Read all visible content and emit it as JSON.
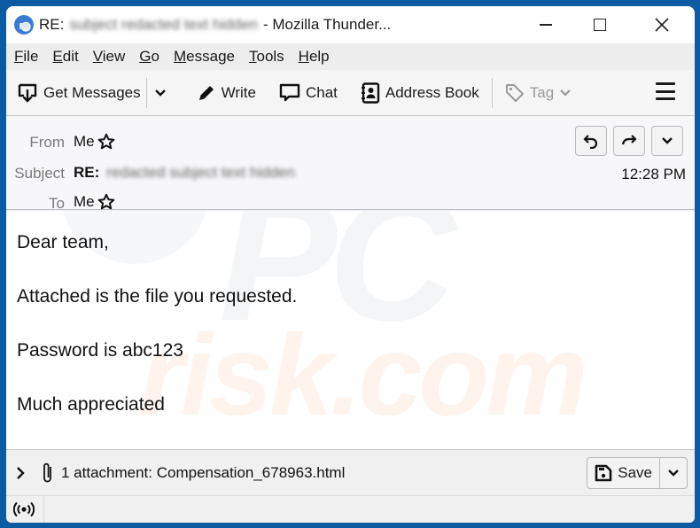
{
  "window": {
    "title_prefix": "RE:",
    "title_redacted": "subject redacted text hidden",
    "title_suffix": "- Mozilla Thunder..."
  },
  "menubar": {
    "items": [
      {
        "key": "F",
        "rest": "ile"
      },
      {
        "key": "E",
        "rest": "dit"
      },
      {
        "key": "V",
        "rest": "iew"
      },
      {
        "key": "G",
        "rest": "o"
      },
      {
        "key": "M",
        "rest": "essage"
      },
      {
        "key": "T",
        "rest": "ools"
      },
      {
        "key": "H",
        "rest": "elp"
      }
    ]
  },
  "toolbar": {
    "get_messages": "Get Messages",
    "write": "Write",
    "chat": "Chat",
    "address_book": "Address Book",
    "tag": "Tag"
  },
  "header": {
    "from_label": "From",
    "from_value": "Me",
    "subject_label": "Subject",
    "subject_prefix": "RE:",
    "subject_redacted": "redacted subject text hidden",
    "to_label": "To",
    "to_value": "Me",
    "time": "12:28 PM"
  },
  "body": {
    "paragraphs": [
      "Dear team,",
      "Attached is the file you requested.",
      "Password is abc123",
      "Much appreciated"
    ],
    "watermark_top": "PC",
    "watermark_bottom": "risk.com"
  },
  "attachment": {
    "summary": "1 attachment: Compensation_678963.html",
    "save_label": "Save"
  },
  "colors": {
    "window_frame": "#0b5aa2",
    "titlebar": "#ffffff",
    "menubar": "#ededed"
  }
}
